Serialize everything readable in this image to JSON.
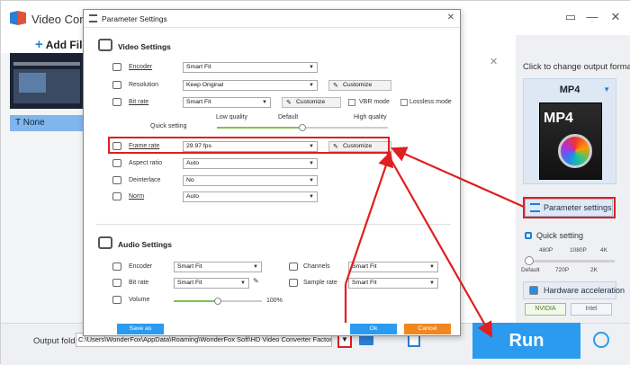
{
  "app": {
    "title": "Video Converter Factory Pro",
    "add_files": "Add Files",
    "file_subtitle": "None",
    "click_output_label": "Click to change output format:",
    "format": "MP4",
    "format_icon_label": "MP4",
    "param_settings": "Parameter settings",
    "quick_setting": "Quick setting",
    "quick_ticks_top": [
      "480P",
      "1080P",
      "4K"
    ],
    "quick_ticks_bottom": [
      "Default",
      "720P",
      "2K"
    ],
    "quick_level": 0,
    "hw_accel": "Hardware acceleration",
    "nvidia": "NVIDIA",
    "intel": "Intel",
    "output_folder_label": "Output folder:",
    "output_folder_value": "C:\\Users\\WonderFox\\AppData\\Roaming\\WonderFox Soft\\HD Video Converter Factory\\OutputVideo\\",
    "run": "Run",
    "window_controls": [
      "▭",
      "—",
      "✕"
    ]
  },
  "dialog": {
    "title": "Parameter Settings",
    "video_section": "Video Settings",
    "audio_section": "Audio Settings",
    "video_rows": {
      "encoder": {
        "label": "Encoder",
        "value": "Smart Fit"
      },
      "resolution": {
        "label": "Resolution",
        "value": "Keep Original",
        "btn": "Customize"
      },
      "bitrate": {
        "label": "Bit rate",
        "value": "Smart Fit",
        "btn": "Customize",
        "vbr": "VBR mode",
        "lossless": "Lossless mode"
      },
      "quick": {
        "label": "Quick setting",
        "low": "Low quality",
        "default": "Default",
        "high": "High quality",
        "level": 0.5
      },
      "framerate": {
        "label": "Frame rate",
        "value": "29.97 fps",
        "btn": "Customize"
      },
      "aspect": {
        "label": "Aspect ratio",
        "value": "Auto"
      },
      "deinterlace": {
        "label": "Deinterlace",
        "value": "No"
      },
      "norm": {
        "label": "Norm",
        "value": "Auto"
      }
    },
    "audio_rows": {
      "encoder": {
        "label": "Encoder",
        "value": "Smart Fit"
      },
      "channels": {
        "label": "Channels",
        "value": "Smart Fit"
      },
      "bitrate": {
        "label": "Bit rate",
        "value": "Smart Fit"
      },
      "samplerate": {
        "label": "Sample rate",
        "value": "Smart Fit"
      },
      "volume": {
        "label": "Volume",
        "value": "100%",
        "level": 0.5
      }
    },
    "save_as": "Save as",
    "ok": "Ok",
    "cancel": "Cancel"
  },
  "colors": {
    "accent": "#2b9bf0",
    "highlight": "#e01f1f",
    "cancel": "#f0881f",
    "slider": "#7cc24b"
  }
}
